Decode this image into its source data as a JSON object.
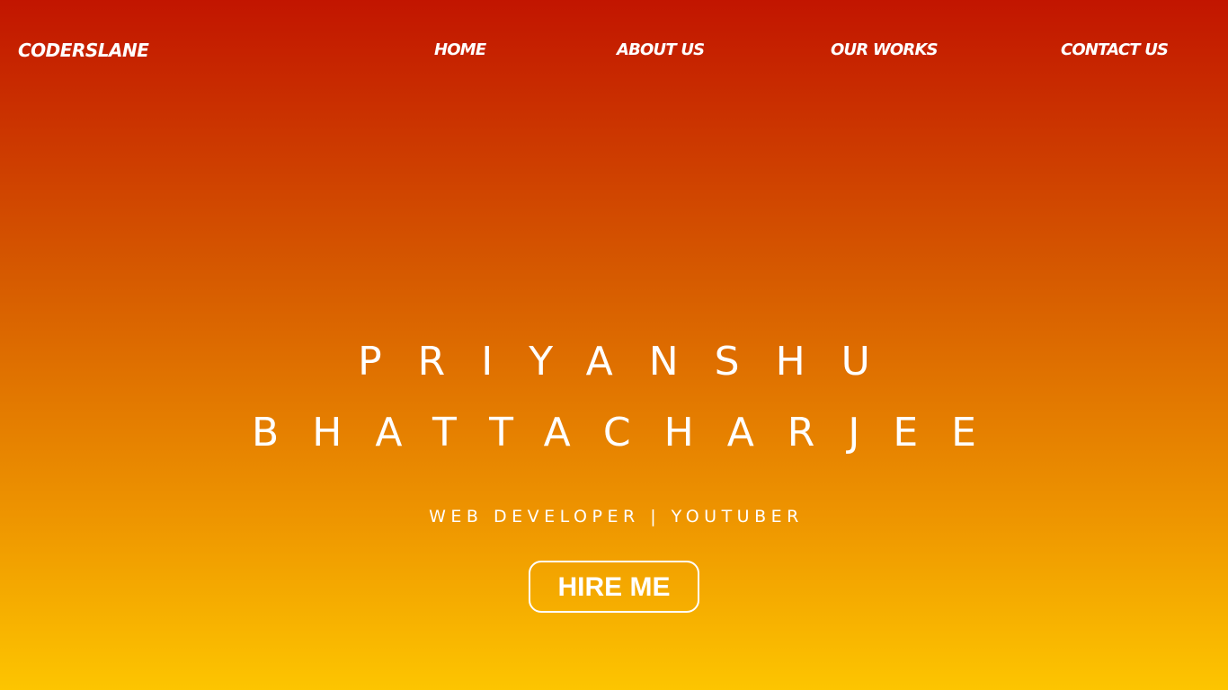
{
  "navbar": {
    "logo": "CODERSLANE",
    "links": [
      {
        "label": "HOME"
      },
      {
        "label": "ABOUT US"
      },
      {
        "label": "OUR WORKS"
      },
      {
        "label": "CONTACT US"
      }
    ]
  },
  "hero": {
    "name_line_1": "PRIYANSHU",
    "name_line_2": "BHATTACHARJEE",
    "subtitle": "WEB DEVELOPER | YOUTUBER",
    "cta_label": "HIRE ME"
  },
  "colors": {
    "gradient_top": "#c21500",
    "gradient_bottom": "#fdc500",
    "text": "#ffffff"
  }
}
